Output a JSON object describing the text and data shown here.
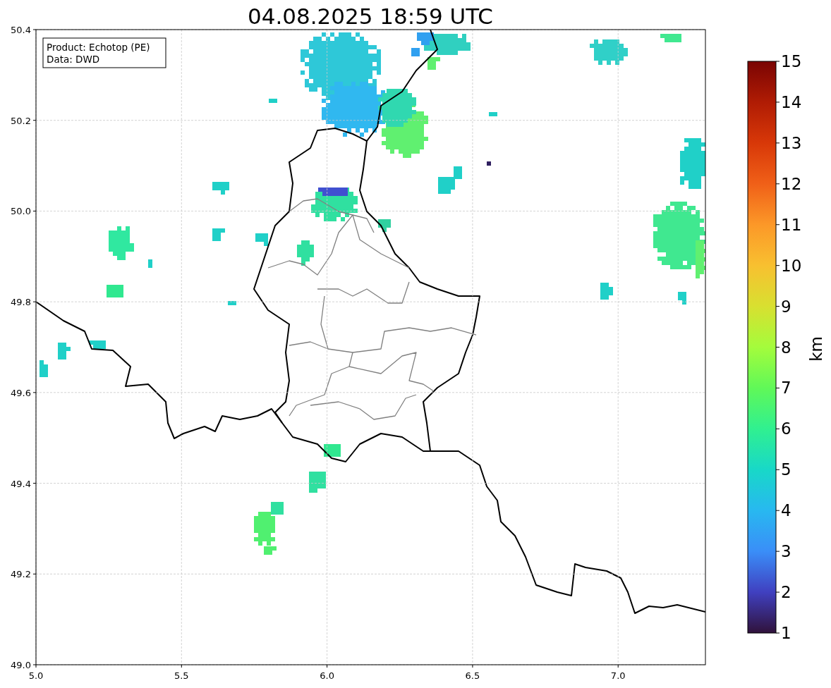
{
  "figure": {
    "legend": [
      "Product: Echotop (PE)",
      "Data: DWD"
    ],
    "chart_data": {
      "type": "scatter",
      "title": "04.08.2025 18:59 UTC",
      "grid": true,
      "xlim": [
        5.0,
        7.3
      ],
      "ylim": [
        49.0,
        50.4
      ],
      "xticks": [
        {
          "value": 5.0,
          "label": "5.0"
        },
        {
          "value": 5.5,
          "label": "5.5"
        },
        {
          "value": 6.0,
          "label": "6.0"
        },
        {
          "value": 6.5,
          "label": "6.5"
        },
        {
          "value": 7.0,
          "label": "7.0"
        }
      ],
      "yticks": [
        {
          "value": 49.0,
          "label": "49.0"
        },
        {
          "value": 49.2,
          "label": "49.2"
        },
        {
          "value": 49.4,
          "label": "49.4"
        },
        {
          "value": 49.6,
          "label": "49.6"
        },
        {
          "value": 49.8,
          "label": "49.8"
        },
        {
          "value": 50.0,
          "label": "50.0"
        },
        {
          "value": 50.2,
          "label": "50.2"
        },
        {
          "value": 50.4,
          "label": "50.4"
        }
      ]
    },
    "colorbar": {
      "label": "km",
      "ticks": [
        "15",
        "14",
        "13",
        "12",
        "11",
        "10",
        "9",
        "8",
        "7",
        "6",
        "5",
        "4",
        "3",
        "2",
        "1"
      ]
    }
  }
}
